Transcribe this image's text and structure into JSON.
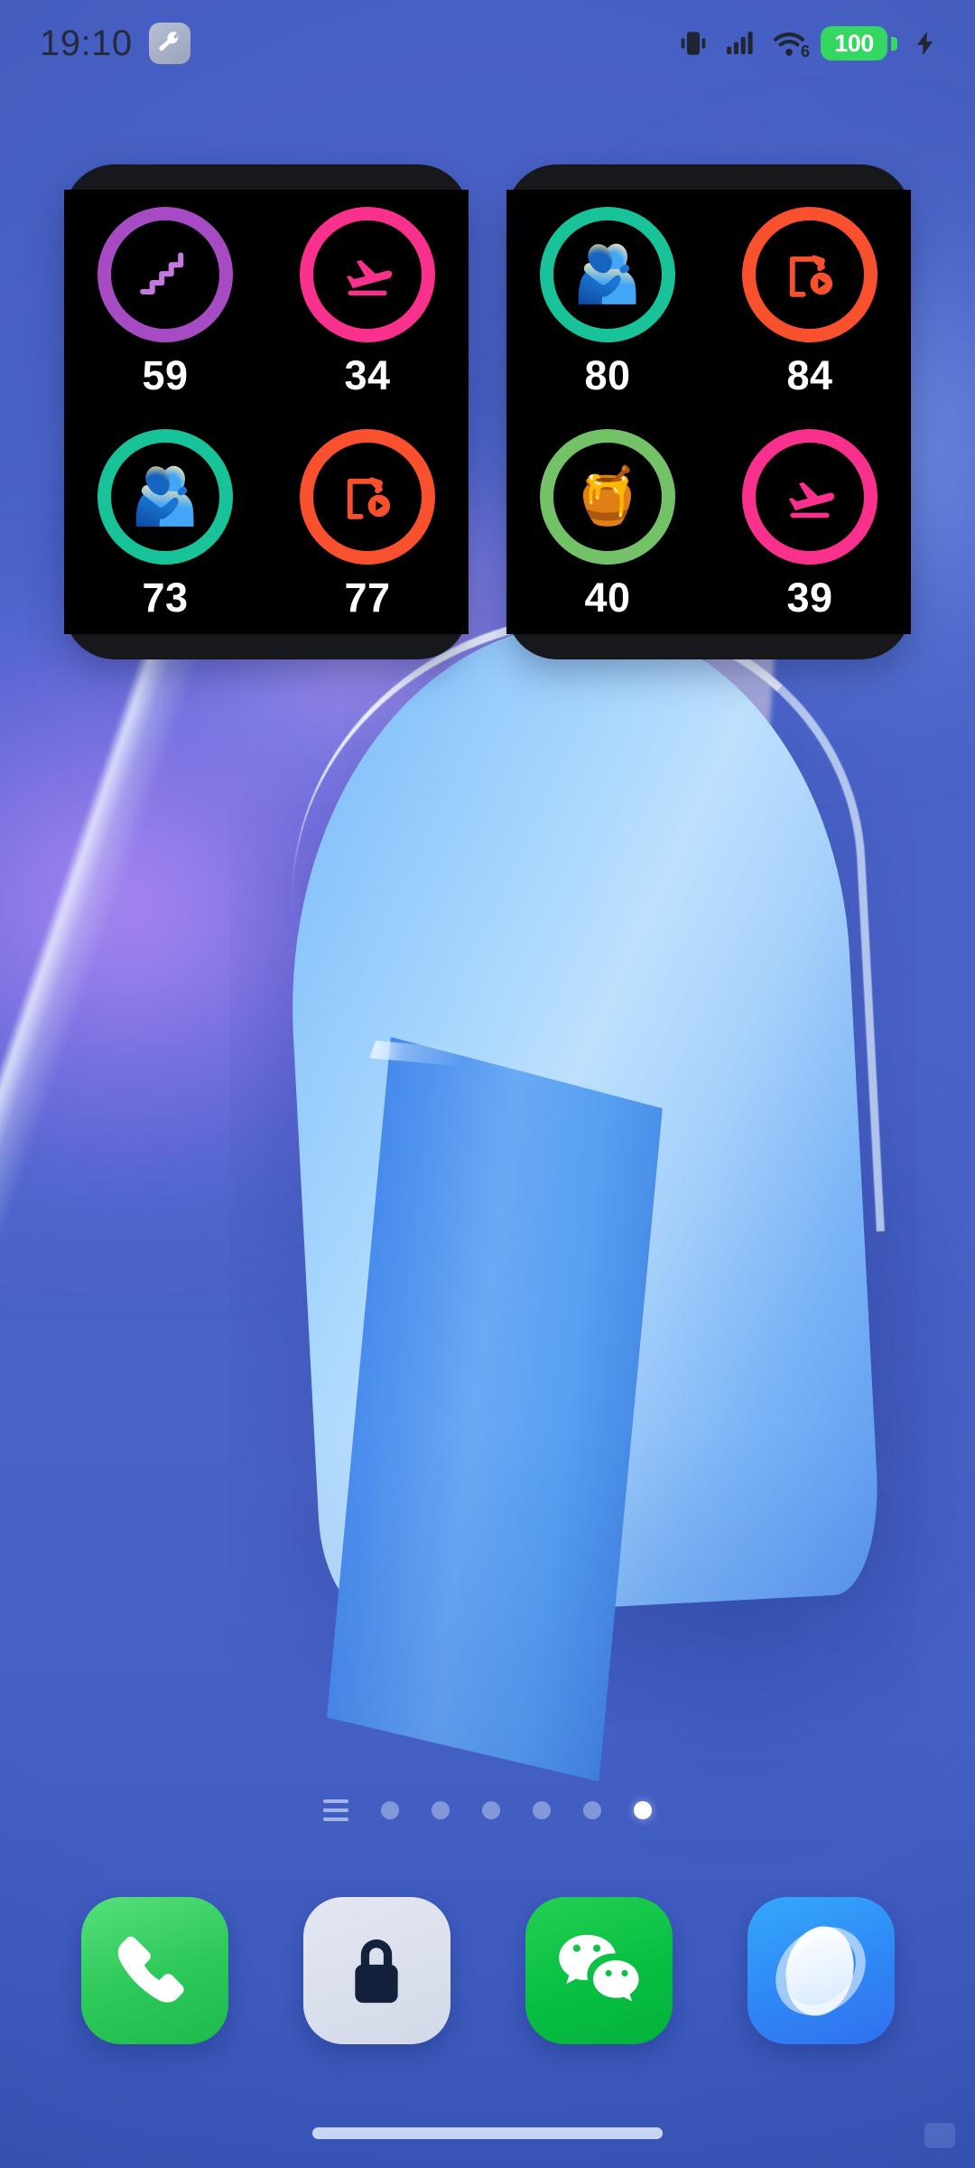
{
  "status_bar": {
    "time": "19:10",
    "tool_icon": "wrench-icon",
    "icons": [
      "vibrate-icon",
      "signal-bars-icon",
      "wifi-6-icon",
      "battery-badge",
      "charging-bolt-icon"
    ],
    "wifi_generation": "6",
    "battery_level": "100",
    "battery_color": "#34d861",
    "charging": true
  },
  "widgets": [
    {
      "name": "shortcut-widget-left",
      "background": "#000000",
      "frame": "#17181c",
      "cells": [
        {
          "icon": "stairs-icon",
          "icon_type": "glyph",
          "ring_color": "#a64bc4",
          "value": "59"
        },
        {
          "icon": "flight-takeoff-icon",
          "icon_type": "glyph",
          "ring_color": "#f9308c",
          "value": "34"
        },
        {
          "icon": "people-hug-icon",
          "icon_type": "emoji",
          "emoji": "🫂",
          "ring_color": "#18c39a",
          "value": "73"
        },
        {
          "icon": "video-file-icon",
          "icon_type": "glyph",
          "ring_color": "#f9512e",
          "value": "77"
        }
      ]
    },
    {
      "name": "shortcut-widget-right",
      "background": "#000000",
      "frame": "#17181c",
      "cells": [
        {
          "icon": "people-hug-icon",
          "icon_type": "emoji",
          "emoji": "🫂",
          "ring_color": "#18c39a",
          "value": "80"
        },
        {
          "icon": "video-file-icon",
          "icon_type": "glyph",
          "ring_color": "#f9512e",
          "value": "84"
        },
        {
          "icon": "honey-pot-icon",
          "icon_type": "emoji",
          "emoji": "🍯",
          "ring_color": "#74c268",
          "value": "40"
        },
        {
          "icon": "flight-takeoff-icon",
          "icon_type": "glyph",
          "ring_color": "#f9308c",
          "value": "39"
        }
      ]
    }
  ],
  "page_indicator": {
    "menu_icon": "list-menu-icon",
    "total_pages": 6,
    "active_index": 5
  },
  "dock": {
    "apps": [
      {
        "name": "phone-app",
        "icon": "phone-handset-icon",
        "color": "#2ec95b"
      },
      {
        "name": "lock-app",
        "icon": "padlock-icon",
        "color": "#d3d9e8"
      },
      {
        "name": "wechat-app",
        "icon": "wechat-bubbles-icon",
        "color": "#07bf42"
      },
      {
        "name": "browser-app",
        "icon": "planet-orbit-icon",
        "color": "#2f87f5"
      }
    ]
  },
  "navigation": {
    "home_bar": "home-gesture-bar"
  }
}
